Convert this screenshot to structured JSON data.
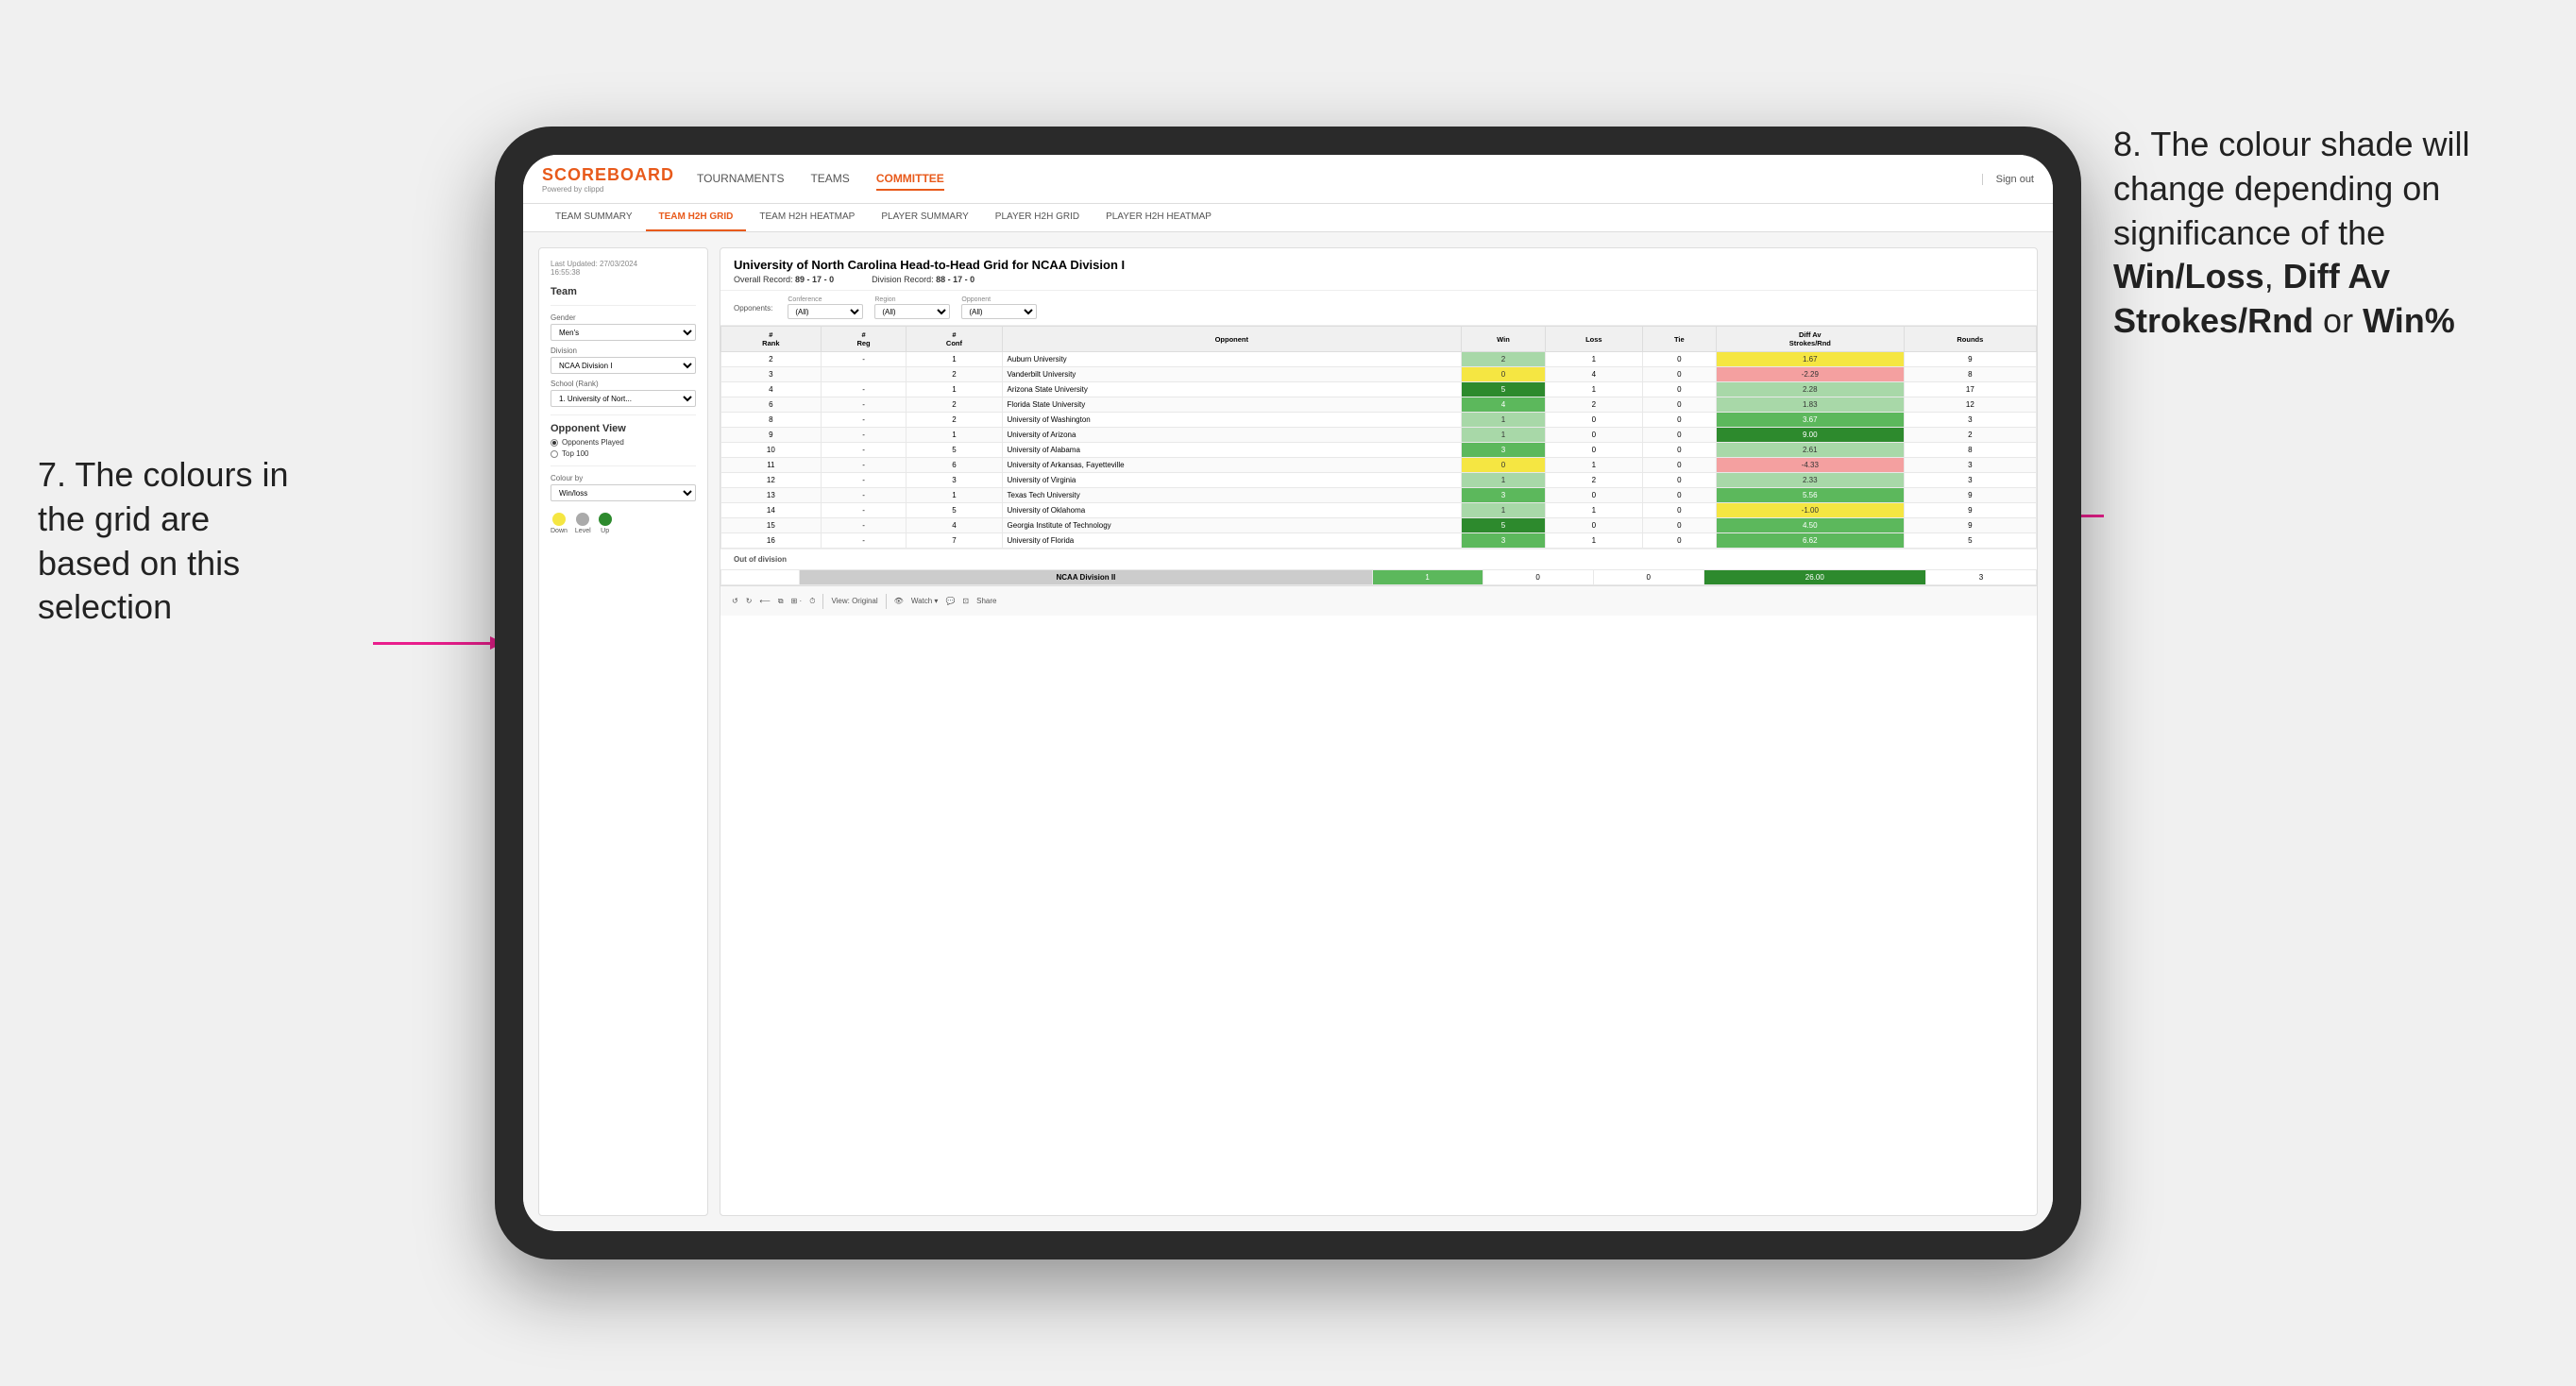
{
  "annotations": {
    "left": "7. The colours in the grid are based on this selection",
    "right_pre": "8. The colour shade will change depending on significance of the ",
    "right_bold1": "Win/Loss",
    "right_sep1": ", ",
    "right_bold2": "Diff Av Strokes/Rnd",
    "right_sep2": " or ",
    "right_bold3": "Win%"
  },
  "header": {
    "logo": "SCOREBOARD",
    "logo_sub": "Powered by clippd",
    "nav": [
      "TOURNAMENTS",
      "TEAMS",
      "COMMITTEE"
    ],
    "active_nav": "COMMITTEE",
    "sign_out": "Sign out"
  },
  "sub_nav": [
    "TEAM SUMMARY",
    "TEAM H2H GRID",
    "TEAM H2H HEATMAP",
    "PLAYER SUMMARY",
    "PLAYER H2H GRID",
    "PLAYER H2H HEATMAP"
  ],
  "active_sub_nav": "TEAM H2H GRID",
  "left_panel": {
    "timestamp": "Last Updated: 27/03/2024\n16:55:38",
    "team_label": "Team",
    "gender_label": "Gender",
    "gender_value": "Men's",
    "division_label": "Division",
    "division_value": "NCAA Division I",
    "school_label": "School (Rank)",
    "school_value": "1. University of Nort...",
    "opponent_view_label": "Opponent View",
    "opponent_option1": "Opponents Played",
    "opponent_option2": "Top 100",
    "colour_by_label": "Colour by",
    "colour_by_value": "Win/loss",
    "legend": {
      "down_label": "Down",
      "level_label": "Level",
      "up_label": "Up"
    }
  },
  "grid": {
    "title": "University of North Carolina Head-to-Head Grid for NCAA Division I",
    "overall_record_label": "Overall Record:",
    "overall_record": "89 - 17 - 0",
    "division_record_label": "Division Record:",
    "division_record": "88 - 17 - 0",
    "filters": {
      "conference_label": "Conference",
      "conference_value": "(All)",
      "region_label": "Region",
      "region_value": "(All)",
      "opponent_label": "Opponent",
      "opponent_value": "(All)",
      "opponents_prefix": "Opponents:"
    },
    "columns": [
      "#\nRank",
      "#\nReg",
      "#\nConf",
      "Opponent",
      "Win",
      "Loss",
      "Tie",
      "Diff Av\nStrokes/Rnd",
      "Rounds"
    ],
    "rows": [
      {
        "rank": "2",
        "reg": "-",
        "conf": "1",
        "opponent": "Auburn University",
        "win": "2",
        "loss": "1",
        "tie": "0",
        "diff": "1.67",
        "rounds": "9",
        "win_color": "green_light",
        "diff_color": "yellow"
      },
      {
        "rank": "3",
        "reg": "",
        "conf": "2",
        "opponent": "Vanderbilt University",
        "win": "0",
        "loss": "4",
        "tie": "0",
        "diff": "-2.29",
        "rounds": "8",
        "win_color": "yellow",
        "diff_color": "red_light"
      },
      {
        "rank": "4",
        "reg": "-",
        "conf": "1",
        "opponent": "Arizona State University",
        "win": "5",
        "loss": "1",
        "tie": "0",
        "diff": "2.28",
        "rounds": "17",
        "win_color": "green_dark",
        "diff_color": "green_light"
      },
      {
        "rank": "6",
        "reg": "-",
        "conf": "2",
        "opponent": "Florida State University",
        "win": "4",
        "loss": "2",
        "tie": "0",
        "diff": "1.83",
        "rounds": "12",
        "win_color": "green_med",
        "diff_color": "green_light"
      },
      {
        "rank": "8",
        "reg": "-",
        "conf": "2",
        "opponent": "University of Washington",
        "win": "1",
        "loss": "0",
        "tie": "0",
        "diff": "3.67",
        "rounds": "3",
        "win_color": "green_light",
        "diff_color": "green_med"
      },
      {
        "rank": "9",
        "reg": "-",
        "conf": "1",
        "opponent": "University of Arizona",
        "win": "1",
        "loss": "0",
        "tie": "0",
        "diff": "9.00",
        "rounds": "2",
        "win_color": "green_light",
        "diff_color": "green_dark"
      },
      {
        "rank": "10",
        "reg": "-",
        "conf": "5",
        "opponent": "University of Alabama",
        "win": "3",
        "loss": "0",
        "tie": "0",
        "diff": "2.61",
        "rounds": "8",
        "win_color": "green_med",
        "diff_color": "green_light"
      },
      {
        "rank": "11",
        "reg": "-",
        "conf": "6",
        "opponent": "University of Arkansas, Fayetteville",
        "win": "0",
        "loss": "1",
        "tie": "0",
        "diff": "-4.33",
        "rounds": "3",
        "win_color": "yellow",
        "diff_color": "red_light"
      },
      {
        "rank": "12",
        "reg": "-",
        "conf": "3",
        "opponent": "University of Virginia",
        "win": "1",
        "loss": "2",
        "tie": "0",
        "diff": "2.33",
        "rounds": "3",
        "win_color": "green_light",
        "diff_color": "green_light"
      },
      {
        "rank": "13",
        "reg": "-",
        "conf": "1",
        "opponent": "Texas Tech University",
        "win": "3",
        "loss": "0",
        "tie": "0",
        "diff": "5.56",
        "rounds": "9",
        "win_color": "green_med",
        "diff_color": "green_med"
      },
      {
        "rank": "14",
        "reg": "-",
        "conf": "5",
        "opponent": "University of Oklahoma",
        "win": "1",
        "loss": "1",
        "tie": "0",
        "diff": "-1.00",
        "rounds": "9",
        "win_color": "green_light",
        "diff_color": "yellow"
      },
      {
        "rank": "15",
        "reg": "-",
        "conf": "4",
        "opponent": "Georgia Institute of Technology",
        "win": "5",
        "loss": "0",
        "tie": "0",
        "diff": "4.50",
        "rounds": "9",
        "win_color": "green_dark",
        "diff_color": "green_med"
      },
      {
        "rank": "16",
        "reg": "-",
        "conf": "7",
        "opponent": "University of Florida",
        "win": "3",
        "loss": "1",
        "tie": "0",
        "diff": "6.62",
        "rounds": "5",
        "win_color": "green_med",
        "diff_color": "green_med"
      }
    ],
    "out_division_label": "Out of division",
    "out_division_row": {
      "division": "NCAA Division II",
      "win": "1",
      "loss": "0",
      "tie": "0",
      "diff": "26.00",
      "rounds": "3"
    }
  },
  "toolbar": {
    "view_label": "View: Original",
    "watch_label": "Watch ▾",
    "share_label": "Share"
  }
}
